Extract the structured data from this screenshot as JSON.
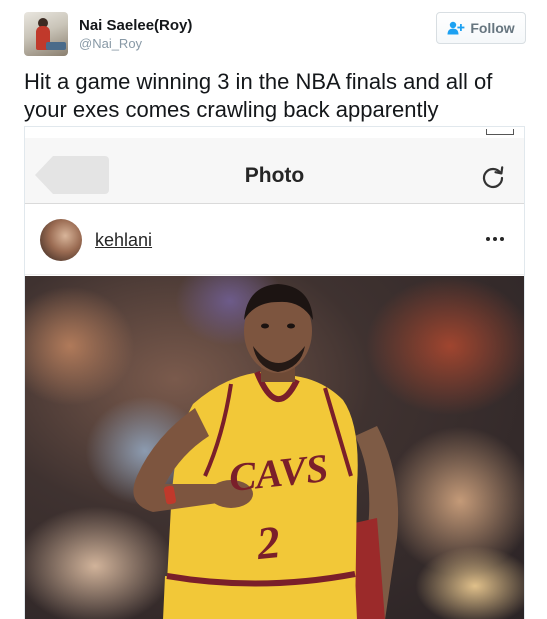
{
  "tweet": {
    "display_name": "Nai Saelee(Roy)",
    "handle": "@Nai_Roy",
    "follow_label": "Follow",
    "text": "Hit a game winning 3 in the NBA finals and all of your exes comes crawling back apparently"
  },
  "embedded_screenshot": {
    "nav_title": "Photo",
    "username": "kehlani",
    "icons": [
      "back-arrow",
      "refresh-icon",
      "more-icon",
      "follow-person-plus-icon"
    ],
    "photo_subject": {
      "jersey_text": "CAVS",
      "jersey_number": "2"
    }
  },
  "colors": {
    "follow_icon_blue": "#1da1f2",
    "jersey_gold": "#f2c838",
    "jersey_wine": "#7a1f2a"
  }
}
